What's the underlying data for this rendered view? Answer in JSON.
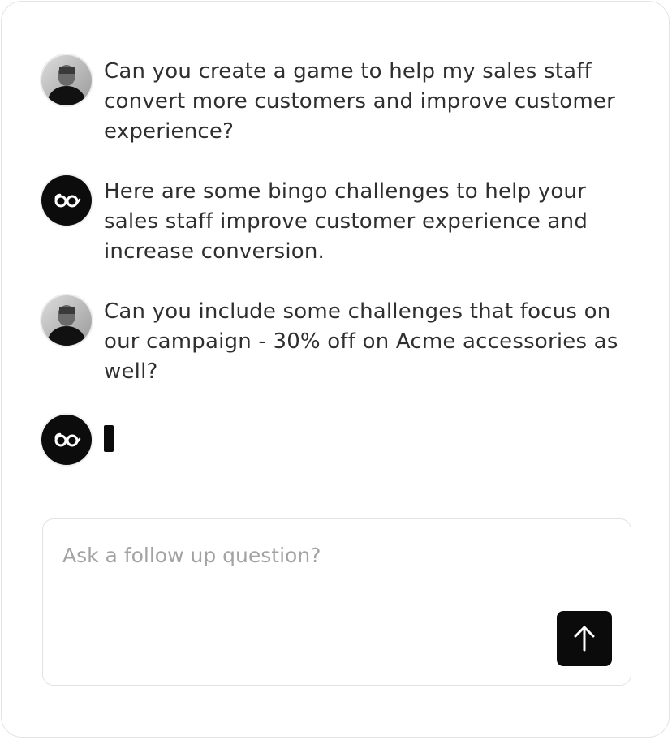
{
  "conversation": {
    "messages": [
      {
        "role": "user",
        "avatar_icon": "user-photo-avatar",
        "text": "Can you create a game to help my sales staff convert more customers and improve customer experience?"
      },
      {
        "role": "assistant",
        "avatar_icon": "glasses-logo-icon",
        "text": "Here are some bingo challenges to help your sales staff improve customer experience and increase conversion."
      },
      {
        "role": "user",
        "avatar_icon": "user-photo-avatar",
        "text": "Can you include some challenges that focus on our campaign - 30% off on Acme accessories as well?"
      },
      {
        "role": "assistant",
        "avatar_icon": "glasses-logo-icon",
        "text": "",
        "state": "typing"
      }
    ]
  },
  "composer": {
    "placeholder": "Ask a follow up question?",
    "value": "",
    "send_icon": "arrow-up-icon"
  },
  "colors": {
    "text": "#2f2f2f",
    "placeholder": "#a3a3a3",
    "accent": "#0b0b0b",
    "border": "#e2e2e2"
  }
}
